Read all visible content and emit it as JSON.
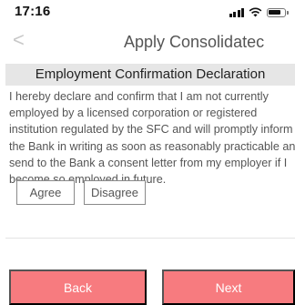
{
  "status_bar": {
    "time": "17:16",
    "icons": [
      "signal-icon",
      "wifi-icon",
      "battery-icon"
    ]
  },
  "nav": {
    "back_icon": "chevron-left-icon",
    "back_glyph": "<",
    "title": "Apply Consolidatec"
  },
  "section": {
    "title": "Employment Confirmation Declaration"
  },
  "declaration": {
    "lines": [
      "I hereby declare and confirm that I am not currently",
      "employed by a licensed corporation or registered",
      "institution regulated by the SFC and will promptly inform",
      "the Bank in writing as soon as reasonably practicable and",
      "send to the Bank a consent letter from my employer if I",
      "become so employed in future."
    ]
  },
  "options": {
    "agree_label": "Agree",
    "disagree_label": "Disagree"
  },
  "actions": {
    "back_label": "Back",
    "next_label": "Next"
  },
  "colors": {
    "action_button": "#f77b7f",
    "section_header_bg": "#e6e6e6"
  }
}
